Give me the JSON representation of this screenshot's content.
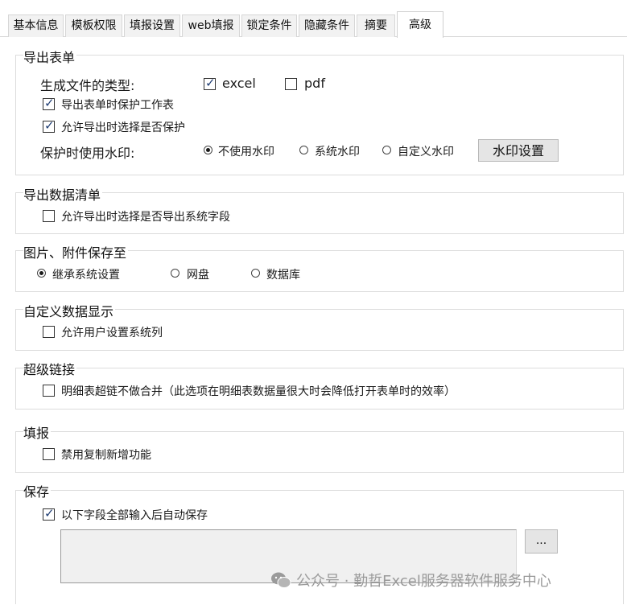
{
  "tabs": [
    {
      "label": "基本信息",
      "active": false
    },
    {
      "label": "模板权限",
      "active": false
    },
    {
      "label": "填报设置",
      "active": false
    },
    {
      "label": "web填报",
      "active": false
    },
    {
      "label": "锁定条件",
      "active": false
    },
    {
      "label": "隐藏条件",
      "active": false
    },
    {
      "label": "摘要",
      "active": false
    },
    {
      "label": "高级",
      "active": true
    }
  ],
  "export_form": {
    "legend": "导出表单",
    "file_type_label": "生成文件的类型:",
    "excel_label": "excel",
    "excel_checked": true,
    "pdf_label": "pdf",
    "pdf_checked": false,
    "protect_sheet_label": "导出表单时保护工作表",
    "protect_sheet_checked": true,
    "allow_choose_protect_label": "允许导出时选择是否保护",
    "allow_choose_protect_checked": true,
    "watermark_label": "保护时使用水印:",
    "watermark_options": [
      "不使用水印",
      "系统水印",
      "自定义水印"
    ],
    "watermark_selected": "不使用水印",
    "watermark_button": "水印设置"
  },
  "export_list": {
    "legend": "导出数据清单",
    "allow_system_fields_label": "允许导出时选择是否导出系统字段",
    "allow_system_fields_checked": false
  },
  "attachments": {
    "legend": "图片、附件保存至",
    "options": [
      "继承系统设置",
      "网盘",
      "数据库"
    ],
    "selected": "继承系统设置"
  },
  "custom_display": {
    "legend": "自定义数据显示",
    "allow_user_columns_label": "允许用户设置系统列",
    "allow_user_columns_checked": false
  },
  "hyperlink": {
    "legend": "超级链接",
    "no_merge_label": "明细表超链不做合并（此选项在明细表数据量很大时会降低打开表单时的效率）",
    "no_merge_checked": false
  },
  "fill": {
    "legend": "填报",
    "disable_copy_label": "禁用复制新增功能",
    "disable_copy_checked": false
  },
  "save": {
    "legend": "保存",
    "autosave_label": "以下字段全部输入后自动保存",
    "autosave_checked": true,
    "fields_value": "",
    "browse_button": "..."
  },
  "watermark_text": "公众号 · 勤哲Excel服务器软件服务中心",
  "watermark_icon": "wechat-icon"
}
